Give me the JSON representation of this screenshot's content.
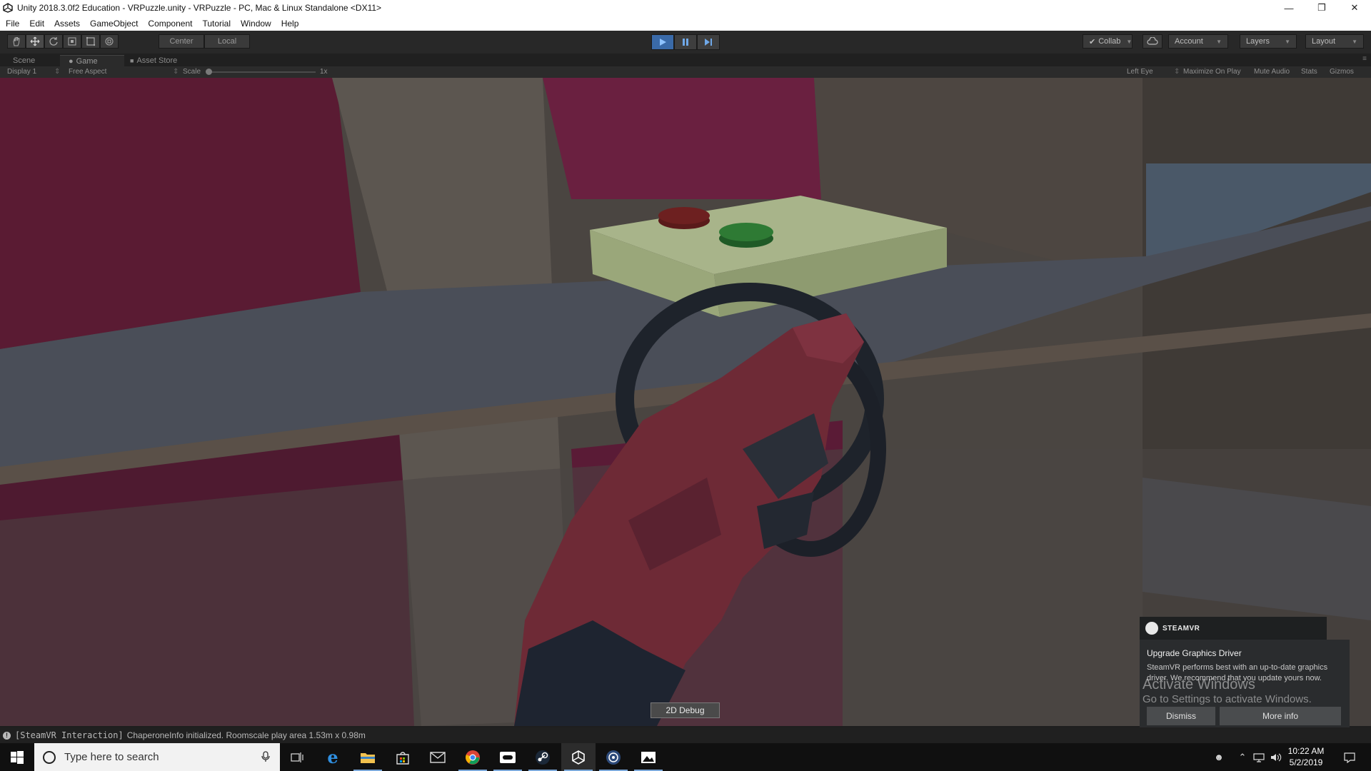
{
  "window": {
    "title": "Unity 2018.3.0f2 Education - VRPuzzle.unity - VRPuzzle - PC, Mac & Linux Standalone <DX11>"
  },
  "menu": [
    "File",
    "Edit",
    "Assets",
    "GameObject",
    "Component",
    "Tutorial",
    "Window",
    "Help"
  ],
  "toolbar": {
    "pivot_label": "Center",
    "space_label": "Local",
    "collab_label": "Collab",
    "account_label": "Account",
    "layers_label": "Layers",
    "layout_label": "Layout"
  },
  "tabs": {
    "scene": "Scene",
    "game": "Game",
    "asset_store": "Asset Store"
  },
  "gamebar": {
    "display": "Display 1",
    "aspect": "Free Aspect",
    "scale_label": "Scale",
    "scale_value": "1x",
    "eye": "Left Eye",
    "maximize": "Maximize On Play",
    "mute": "Mute Audio",
    "stats": "Stats",
    "gizmos": "Gizmos"
  },
  "viewport": {
    "debug_button": "2D Debug"
  },
  "steamvr": {
    "brand": "STEAMVR",
    "title": "Upgrade Graphics Driver",
    "message": "SteamVR performs best with an up-to-date graphics driver. We recommend that you update yours now.",
    "dismiss": "Dismiss",
    "more_info": "More info"
  },
  "watermark": {
    "line1": "Activate Windows",
    "line2": "Go to Settings to activate Windows."
  },
  "status": {
    "tag": "[SteamVR Interaction]",
    "message": "ChaperoneInfo initialized. Roomscale play area 1.53m x 0.98m"
  },
  "taskbar": {
    "search_placeholder": "Type here to search",
    "time": "10:22 AM",
    "date": "5/2/2019"
  },
  "colors": {
    "unity_dark": "#282828",
    "play_active": "#3a6aa8",
    "taskbar": "#101010",
    "steam_panel": "#2a2c2e"
  }
}
